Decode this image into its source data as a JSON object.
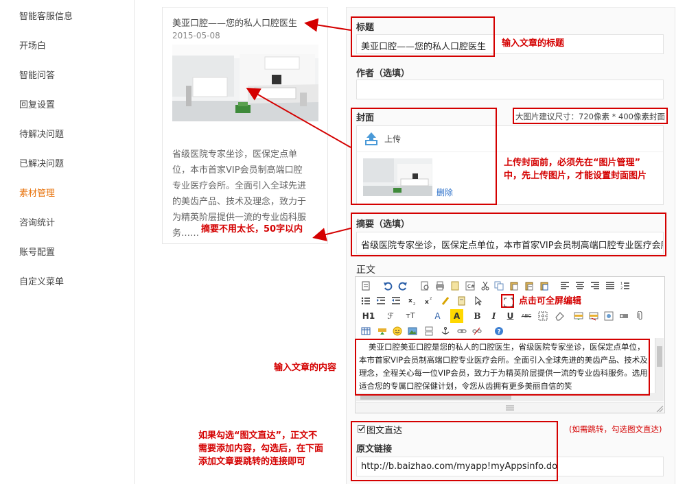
{
  "sidebar": {
    "items": [
      {
        "label": "智能客服信息"
      },
      {
        "label": "开场白"
      },
      {
        "label": "智能问答"
      },
      {
        "label": "回复设置"
      },
      {
        "label": "待解决问题"
      },
      {
        "label": "已解决问题"
      },
      {
        "label": "素材管理"
      },
      {
        "label": "咨询统计"
      },
      {
        "label": "账号配置"
      },
      {
        "label": "自定义菜单"
      }
    ],
    "active_index": 6
  },
  "preview": {
    "title": "美亚口腔——您的私人口腔医生",
    "date": "2015-05-08",
    "desc_lines": [
      "省级医院专家坐诊，医保定点单",
      "位，本市首家VIP会员制高端口腔",
      "专业医疗会所。全面引入全球先进",
      "的美齿产品、技术及理念，致力于",
      "为精英阶层提供一流的专业齿科服",
      "务……"
    ]
  },
  "form": {
    "title_label": "标题",
    "title_value": "美亚口腔——您的私人口腔医生",
    "author_label": "作者（选填）",
    "author_value": "",
    "cover_label": "封面",
    "upload_label": "上传",
    "delete_label": "删除",
    "cover_size_note": "大图片建议尺寸：720像素 * 400像素封面",
    "summary_label": "摘要（选填）",
    "summary_value": "省级医院专家坐诊，医保定点单位，本市首家VIP会员制高端口腔专业医疗会所。",
    "body_label": "正文",
    "body_text": "美亚口腔美亚口腔是您的私人的口腔医生，省级医院专家坐诊，医保定点单位，本市首家VIP会员制高端口腔专业医疗会所。全面引入全球先进的美齿产品、技术及理念，全程关心每一位VIP会员，致力于为精英阶层提供一流的专业齿科服务。选用适合您的专属口腔保健计划，令您从齿拥有更多美丽自信的笑",
    "direct_label": "图文直达",
    "direct_checked": true,
    "orig_link_label": "原文链接",
    "orig_link_value": "http://b.baizhao.com/myapp!myAppsinfo.do"
  },
  "annotations": {
    "title_tip": "输入文章的标题",
    "cover_tip_1": "上传封面前，必须先在“图片管理”",
    "cover_tip_2": "中，先上传图片，才能设置封面图片",
    "summary_tip": "摘要不用太长，50字以内",
    "fullscreen_tip": "点击可全屏编辑",
    "content_tip": "输入文章的内容",
    "direct_tip": "(如需跳转，勾选图文直达)",
    "direct_note_1": "如果勾选“图文直达”，正文不",
    "direct_note_2": "需要添加内容，勾选后，在下面",
    "direct_note_3": "添加文章要跳转的连接即可"
  },
  "colors": {
    "annotation": "#d40000",
    "active_menu": "#e8730c",
    "link": "#2a6fc9"
  },
  "toolbar": {
    "row1": [
      "source-icon",
      "undo-icon",
      "redo-icon",
      "preview-icon",
      "print-icon",
      "template-icon",
      "code-icon",
      "cut-icon",
      "copy-icon",
      "paste-icon",
      "paste-text-icon",
      "paste-word-icon",
      "align-left-icon",
      "align-center-icon",
      "align-right-icon",
      "justify-icon",
      "ordered-list-icon"
    ],
    "row2": [
      "unordered-list-icon",
      "indent-icon",
      "outdent-icon",
      "subscript-icon",
      "superscript-icon",
      "clear-format-icon",
      "select-all-icon",
      "pointer-icon",
      "fullscreen-icon"
    ],
    "row3_text": [
      "H1",
      "ℱ",
      "тT",
      "A",
      "A",
      "B",
      "I",
      "U",
      "ABC"
    ],
    "row3_labels": {
      "bold": "B",
      "italic": "I",
      "underline": "U",
      "strike": "ABC"
    }
  }
}
